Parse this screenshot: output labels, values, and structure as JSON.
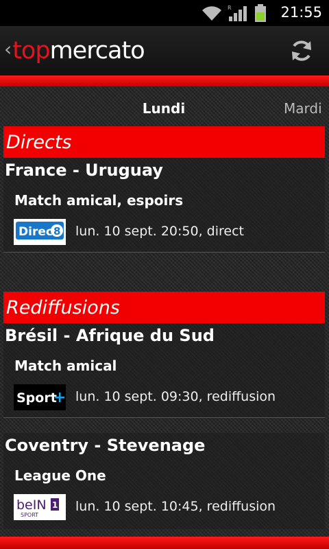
{
  "status": {
    "time": "21:55"
  },
  "app": {
    "logo_part1": "top",
    "logo_part2": "mercato",
    "refresh_icon": "refresh-icon",
    "back_icon": "chevron-left-icon"
  },
  "tabs": [
    {
      "label": "Lundi"
    },
    {
      "label": "Mardi"
    }
  ],
  "sections": [
    {
      "title": "Directs",
      "matches": [
        {
          "teams": "France - Uruguay",
          "competition": "Match amical, espoirs",
          "channel": "Direct 8",
          "broadcast": "lun. 10 sept. 20:50, direct"
        }
      ]
    },
    {
      "title": "Rediffusions",
      "matches": [
        {
          "teams": "Brésil - Afrique du Sud",
          "competition": "Match amical",
          "channel": "Sport+",
          "broadcast": "lun. 10 sept. 09:30, rediffusion"
        },
        {
          "teams": "Coventry - Stevenage",
          "competition": "League One",
          "channel": "beIN Sport 1",
          "broadcast": "lun. 10 sept. 10:45, rediffusion"
        }
      ]
    }
  ],
  "colors": {
    "accent": "#f20000",
    "header": "#111111"
  }
}
